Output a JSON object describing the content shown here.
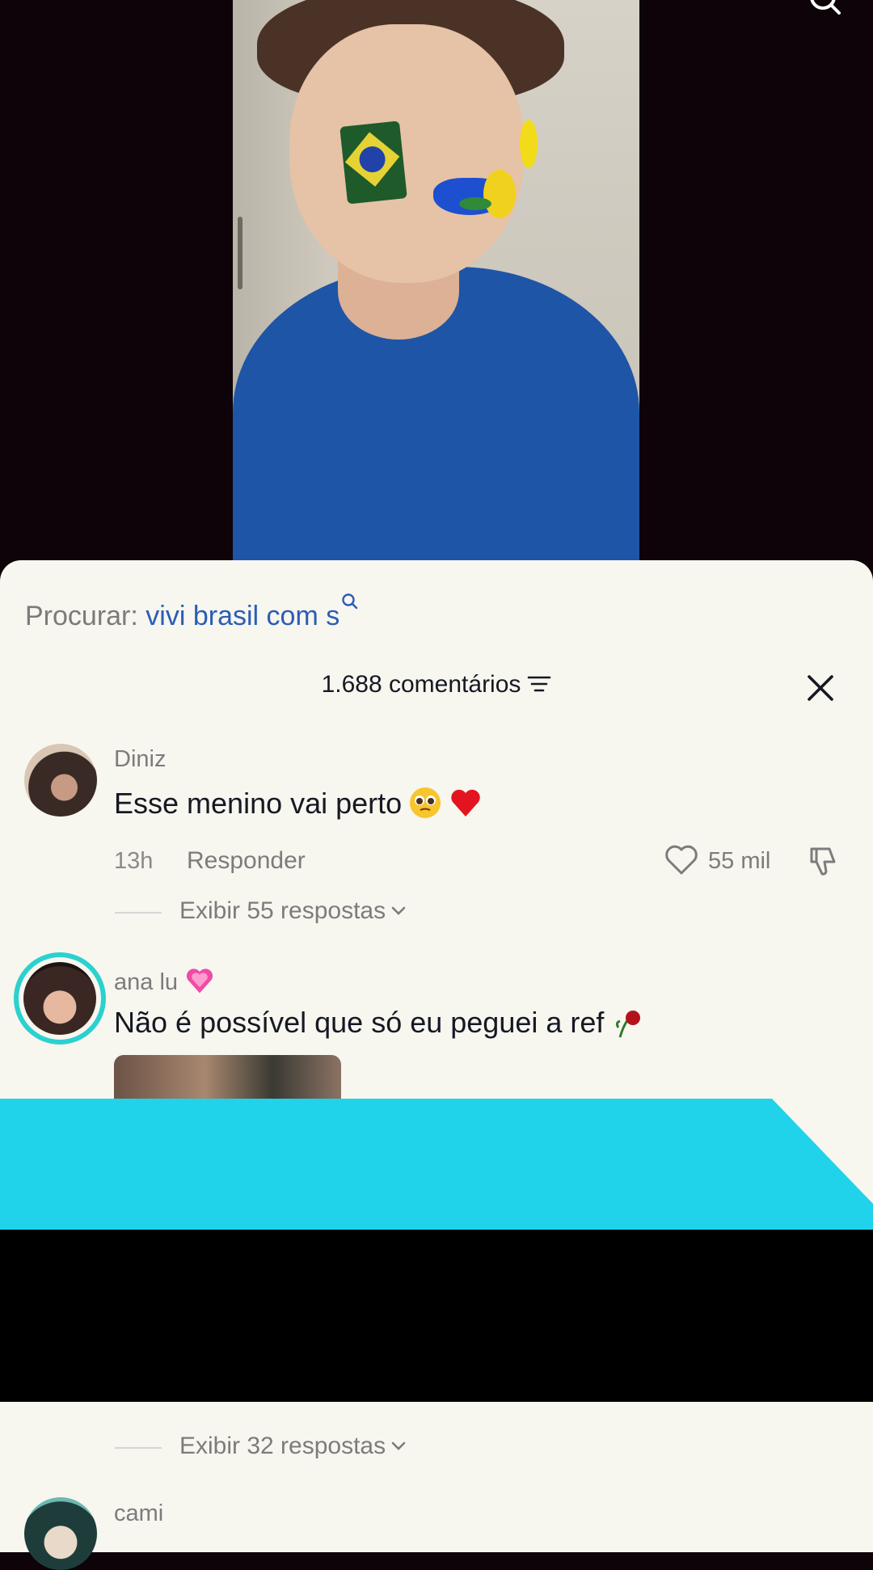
{
  "search": {
    "prefix": "Procurar:",
    "term": "vivi brasil com s"
  },
  "header": {
    "comment_count": "1.688 comentários"
  },
  "comments": [
    {
      "username": "Diniz",
      "text": "Esse menino vai perto",
      "emojis": [
        "pleading-face-emoji",
        "red-heart-emoji"
      ],
      "time": "13h",
      "reply_label": "Responder",
      "likes": "55 mil",
      "view_replies": "Exibir 55 respostas"
    },
    {
      "username": "ana lu",
      "username_emoji": "growing-heart-emoji",
      "text": "Não é possível que só eu peguei a ref",
      "emojis": [
        "wilted-rose-emoji"
      ],
      "has_image": true
    },
    {
      "view_replies": "Exibir 32 respostas"
    },
    {
      "username": "cami"
    }
  ],
  "colors": {
    "sheet_bg": "#f7f6ef",
    "search_term": "#2b5db5",
    "overlay_cyan": "#20d3ea",
    "avatar_ring": "#2bd1cf"
  }
}
